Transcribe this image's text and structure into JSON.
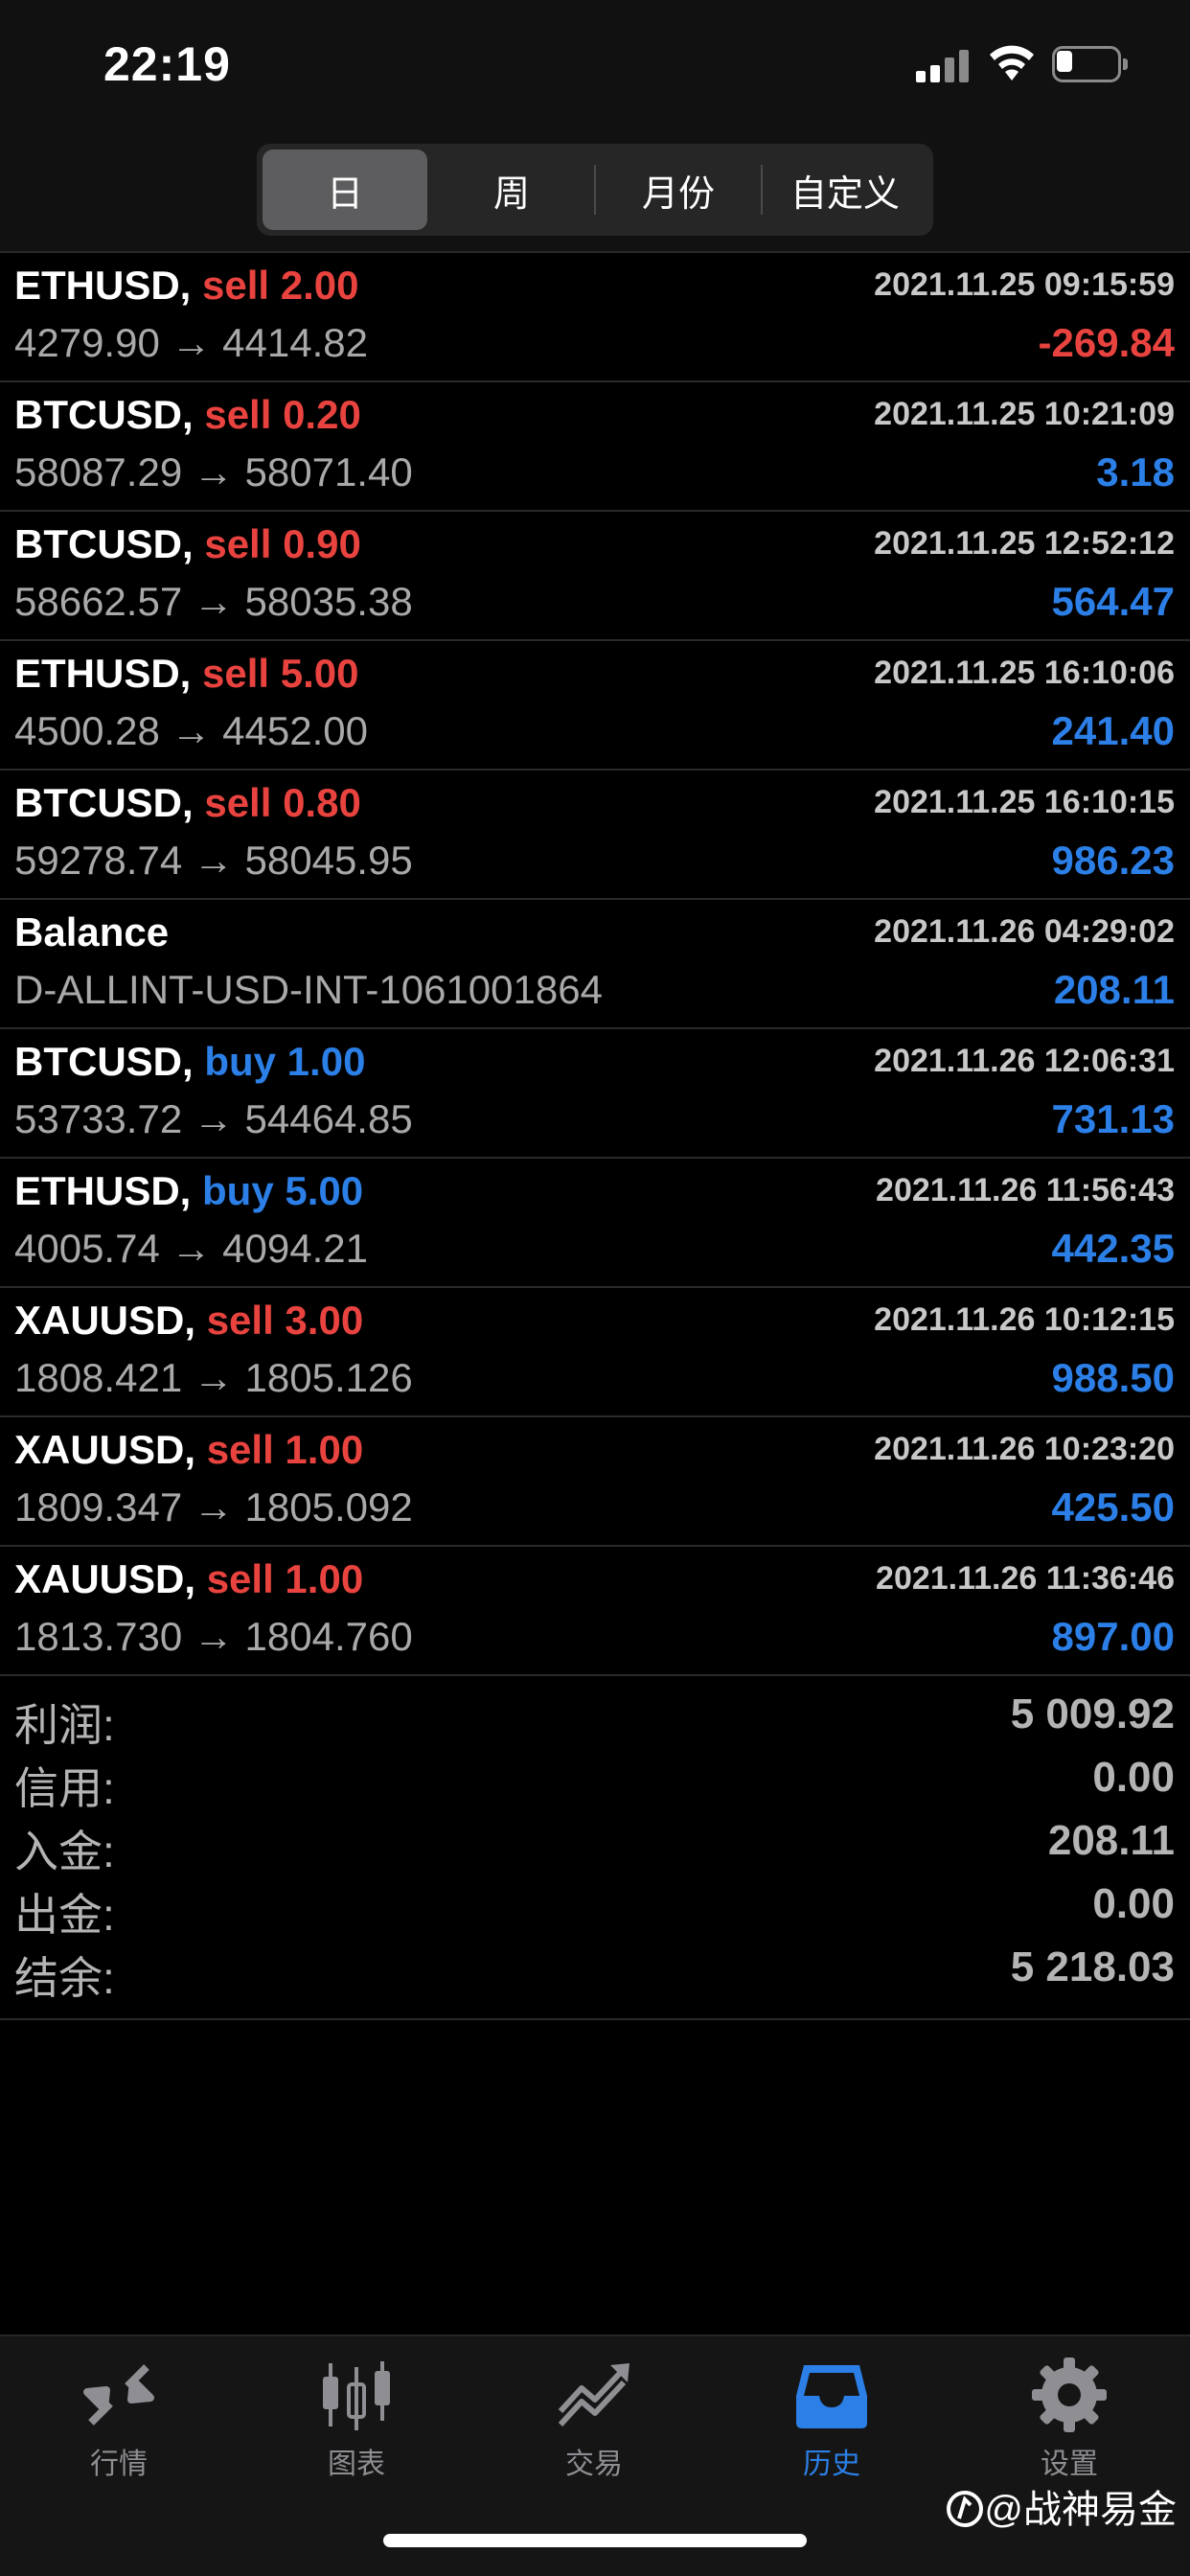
{
  "status_bar": {
    "time": "22:19"
  },
  "segmented_control": [
    {
      "label": "日",
      "selected": true
    },
    {
      "label": "周",
      "selected": false
    },
    {
      "label": "月份",
      "selected": false
    },
    {
      "label": "自定义",
      "selected": false
    }
  ],
  "deals": [
    {
      "symbol": "ETHUSD,",
      "type": "sell",
      "volume_text": "sell 2.00",
      "time": "2021.11.25 09:15:59",
      "prices": "4279.90 → 4414.82",
      "profit": "-269.84",
      "profit_sign": "neg"
    },
    {
      "symbol": "BTCUSD,",
      "type": "sell",
      "volume_text": "sell 0.20",
      "time": "2021.11.25 10:21:09",
      "prices": "58087.29 → 58071.40",
      "profit": "3.18",
      "profit_sign": "pos"
    },
    {
      "symbol": "BTCUSD,",
      "type": "sell",
      "volume_text": "sell 0.90",
      "time": "2021.11.25 12:52:12",
      "prices": "58662.57 → 58035.38",
      "profit": "564.47",
      "profit_sign": "pos"
    },
    {
      "symbol": "ETHUSD,",
      "type": "sell",
      "volume_text": "sell 5.00",
      "time": "2021.11.25 16:10:06",
      "prices": "4500.28 → 4452.00",
      "profit": "241.40",
      "profit_sign": "pos"
    },
    {
      "symbol": "BTCUSD,",
      "type": "sell",
      "volume_text": "sell 0.80",
      "time": "2021.11.25 16:10:15",
      "prices": "59278.74 → 58045.95",
      "profit": "986.23",
      "profit_sign": "pos"
    },
    {
      "symbol": "Balance",
      "type": "",
      "volume_text": "",
      "time": "2021.11.26 04:29:02",
      "prices": "D-ALLINT-USD-INT-1061001864",
      "profit": "208.11",
      "profit_sign": "pos"
    },
    {
      "symbol": "BTCUSD,",
      "type": "buy",
      "volume_text": "buy 1.00",
      "time": "2021.11.26 12:06:31",
      "prices": "53733.72 → 54464.85",
      "profit": "731.13",
      "profit_sign": "pos"
    },
    {
      "symbol": "ETHUSD,",
      "type": "buy",
      "volume_text": "buy 5.00",
      "time": "2021.11.26 11:56:43",
      "prices": "4005.74 → 4094.21",
      "profit": "442.35",
      "profit_sign": "pos"
    },
    {
      "symbol": "XAUUSD,",
      "type": "sell",
      "volume_text": "sell 3.00",
      "time": "2021.11.26 10:12:15",
      "prices": "1808.421 → 1805.126",
      "profit": "988.50",
      "profit_sign": "pos"
    },
    {
      "symbol": "XAUUSD,",
      "type": "sell",
      "volume_text": "sell 1.00",
      "time": "2021.11.26 10:23:20",
      "prices": "1809.347 → 1805.092",
      "profit": "425.50",
      "profit_sign": "pos"
    },
    {
      "symbol": "XAUUSD,",
      "type": "sell",
      "volume_text": "sell 1.00",
      "time": "2021.11.26 11:36:46",
      "prices": "1813.730 → 1804.760",
      "profit": "897.00",
      "profit_sign": "pos"
    }
  ],
  "summary": [
    {
      "label": "利润:",
      "value": "5 009.92"
    },
    {
      "label": "信用:",
      "value": "0.00"
    },
    {
      "label": "入金:",
      "value": "208.11"
    },
    {
      "label": "出金:",
      "value": "0.00"
    },
    {
      "label": "结余:",
      "value": "5 218.03"
    }
  ],
  "tab_bar": [
    {
      "label": "行情",
      "icon": "quotes-icon",
      "active": false
    },
    {
      "label": "图表",
      "icon": "chart-icon",
      "active": false
    },
    {
      "label": "交易",
      "icon": "trade-icon",
      "active": false
    },
    {
      "label": "历史",
      "icon": "history-icon",
      "active": true
    },
    {
      "label": "设置",
      "icon": "settings-icon",
      "active": false
    }
  ],
  "watermark": "@战神易金",
  "colors": {
    "sell": "#e8433f",
    "buy": "#2b7fe6",
    "active_tab": "#2b7fe6",
    "inactive_tab": "#8e8e93"
  }
}
